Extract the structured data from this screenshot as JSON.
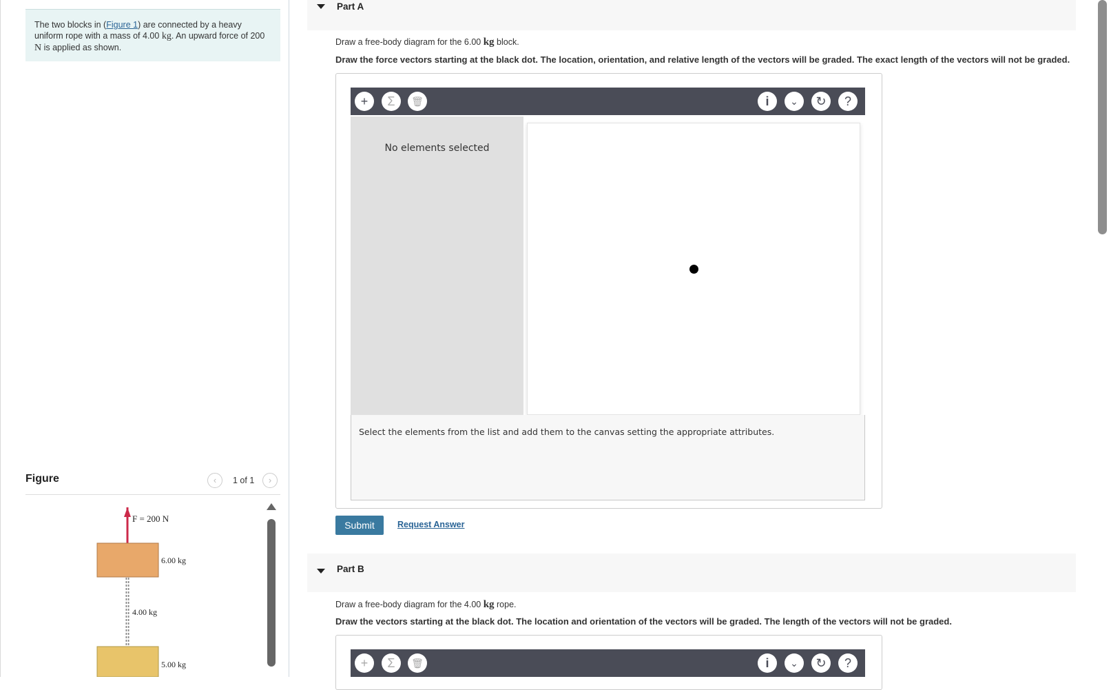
{
  "problem": {
    "text_before_link": "The two blocks in (",
    "link": "Figure 1",
    "text_after_link": ") are connected by a heavy uniform rope with a mass of 4.00 ",
    "unit_kg": "kg",
    "text_mid": ". An upward force of 200 ",
    "unit_N": "N",
    "text_end": " is applied as shown."
  },
  "figure": {
    "title": "Figure",
    "page_indicator": "1 of 1",
    "prev_icon": "chevron-left-icon",
    "next_icon": "chevron-right-icon",
    "force_label": "F = 200 N",
    "top_block_mass": "6.00 kg",
    "rope_mass": "4.00 kg",
    "bottom_block_mass": "5.00 kg",
    "colors": {
      "top_block": "#e8a86a",
      "bottom_block": "#e8c46a",
      "force_arrow": "#cc2a4a"
    }
  },
  "partA": {
    "label": "Part A",
    "prompt_before": "Draw a free-body diagram for the 6.00 ",
    "prompt_unit": "kg",
    "prompt_after": " block.",
    "instruction": "Draw the force vectors starting at the black dot. The location, orientation, and relative length of the vectors will be graded. The exact length of the vectors will not be graded.",
    "panel_status": "No elements selected",
    "info": "Select the elements from the list and add them to the canvas setting the appropriate attributes.",
    "submit": "Submit",
    "request": "Request Answer"
  },
  "partB": {
    "label": "Part B",
    "prompt_before": "Draw a free-body diagram for the 4.00 ",
    "prompt_unit": "kg",
    "prompt_after": " rope.",
    "instruction": "Draw the vectors starting at the black dot. The location and orientation of the vectors will be graded. The length of the vectors will not be graded."
  },
  "toolbar": {
    "add": "+",
    "sum": "Σ",
    "info": "i",
    "reset": "↻",
    "help": "?",
    "icons": [
      "plus-icon",
      "sigma-icon",
      "trash-icon",
      "info-icon",
      "chevron-down-icon",
      "reset-icon",
      "help-icon"
    ],
    "bg": "#4a4c57"
  }
}
